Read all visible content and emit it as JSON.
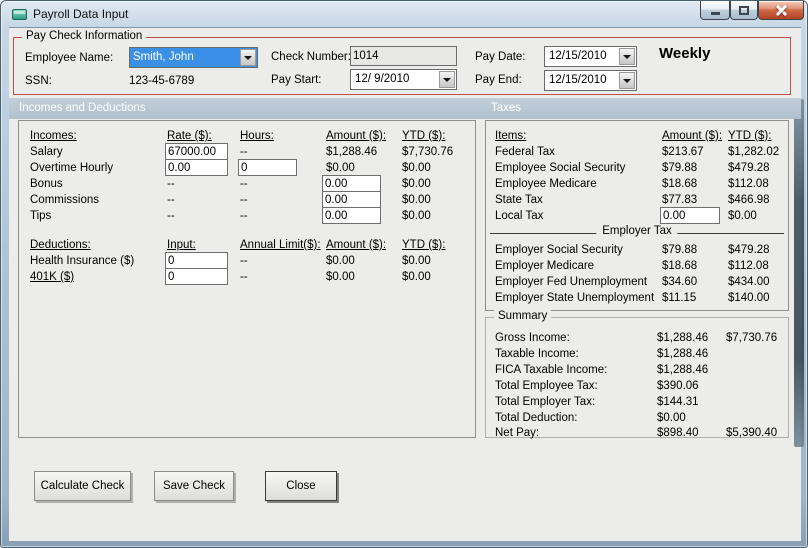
{
  "window": {
    "title": "Payroll Data Input"
  },
  "paycheck": {
    "group_label": "Pay Check Information",
    "employee_name_label": "Employee Name:",
    "employee_name_value": "Smith, John",
    "ssn_label": "SSN:",
    "ssn_value": "123-45-6789",
    "check_number_label": "Check Number:",
    "check_number_value": "1014",
    "pay_start_label": "Pay Start:",
    "pay_start_value": "12/ 9/2010",
    "pay_date_label": "Pay Date:",
    "pay_date_value": "12/15/2010",
    "pay_end_label": "Pay End:",
    "pay_end_value": "12/15/2010",
    "frequency": "Weekly"
  },
  "sections": {
    "left": "Incomes and Deductions",
    "right": "Taxes"
  },
  "incomes": {
    "headers": {
      "item": "Incomes:",
      "rate": "Rate ($):",
      "hours": "Hours:",
      "amount": "Amount ($):",
      "ytd": "YTD ($):"
    },
    "rows": [
      {
        "label": "Salary",
        "rate": "67000.00",
        "hours": "--",
        "amount": "$1,288.46",
        "ytd": "$7,730.76"
      },
      {
        "label": "Overtime Hourly",
        "rate": "0.00",
        "hours": "0",
        "amount": "$0.00",
        "ytd": "$0.00"
      },
      {
        "label": "Bonus",
        "rate": "--",
        "hours": "--",
        "amount": "0.00",
        "ytd": "$0.00"
      },
      {
        "label": "Commissions",
        "rate": "--",
        "hours": "--",
        "amount": "0.00",
        "ytd": "$0.00"
      },
      {
        "label": "Tips",
        "rate": "--",
        "hours": "--",
        "amount": "0.00",
        "ytd": "$0.00"
      }
    ]
  },
  "deductions": {
    "headers": {
      "item": "Deductions:",
      "input": "Input:",
      "annual_limit": "Annual Limit($):",
      "amount": "Amount ($):",
      "ytd": "YTD ($):"
    },
    "rows": [
      {
        "label": "Health Insurance  ($)",
        "input": "0",
        "annual_limit": "--",
        "amount": "$0.00",
        "ytd": "$0.00"
      },
      {
        "label": "401K  ($)",
        "input": "0",
        "annual_limit": "--",
        "amount": "$0.00",
        "ytd": "$0.00"
      }
    ]
  },
  "taxes": {
    "headers": {
      "item": "Items:",
      "amount": "Amount ($):",
      "ytd": "YTD ($):"
    },
    "employee_rows": [
      {
        "label": "Federal Tax",
        "amount": "$213.67",
        "ytd": "$1,282.02"
      },
      {
        "label": "Employee Social Security",
        "amount": "$79.88",
        "ytd": "$479.28"
      },
      {
        "label": "Employee Medicare",
        "amount": "$18.68",
        "ytd": "$112.08"
      },
      {
        "label": "State Tax",
        "amount": "$77.83",
        "ytd": "$466.98"
      },
      {
        "label": "Local Tax",
        "amount": "0.00",
        "ytd": "$0.00"
      }
    ],
    "employer_group_label": "Employer Tax",
    "employer_rows": [
      {
        "label": "Employer Social Security",
        "amount": "$79.88",
        "ytd": "$479.28"
      },
      {
        "label": "Employer Medicare",
        "amount": "$18.68",
        "ytd": "$112.08"
      },
      {
        "label": "Employer Fed Unemployment",
        "amount": "$34.60",
        "ytd": "$434.00"
      },
      {
        "label": "Employer State Unemployment",
        "amount": "$11.15",
        "ytd": "$140.00"
      }
    ]
  },
  "summary": {
    "group_label": "Summary",
    "rows": [
      {
        "label": "Gross Income:",
        "amount": "$1,288.46",
        "ytd": "$7,730.76"
      },
      {
        "label": "Taxable Income:",
        "amount": "$1,288.46",
        "ytd": ""
      },
      {
        "label": "FICA Taxable Income:",
        "amount": "$1,288.46",
        "ytd": ""
      },
      {
        "label": "Total Employee Tax:",
        "amount": "$390.06",
        "ytd": ""
      },
      {
        "label": "Total Employer Tax:",
        "amount": "$144.31",
        "ytd": ""
      },
      {
        "label": "Total Deduction:",
        "amount": "$0.00",
        "ytd": ""
      },
      {
        "label": "Net Pay:",
        "amount": "$898.40",
        "ytd": "$5,390.40"
      }
    ]
  },
  "buttons": {
    "calculate": "Calculate Check",
    "save": "Save Check",
    "close": "Close"
  },
  "icons": {
    "titlebar": "form-icon",
    "minimize": "minimize-icon",
    "maximize": "maximize-icon",
    "close": "close-icon",
    "dropdown": "chevron-down-icon"
  },
  "colors": {
    "group_border_red": "#bf4f49",
    "selection_blue": "#3a90e6",
    "section_header_bg": "#b7c5d1",
    "close_button_red": "#b34224",
    "client_bg": "#ececea"
  }
}
